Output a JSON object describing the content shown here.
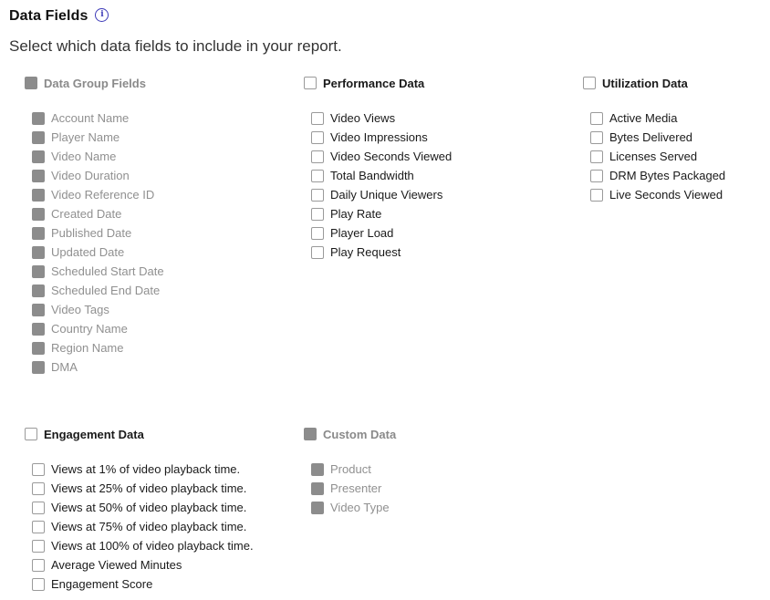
{
  "header": {
    "title": "Data Fields",
    "info_icon": "info-circle-icon"
  },
  "subtitle": "Select which data fields to include in your report.",
  "groups": {
    "data_group": {
      "label": "Data Group Fields",
      "items": [
        "Account Name",
        "Player Name",
        "Video Name",
        "Video Duration",
        "Video Reference ID",
        "Created Date",
        "Published Date",
        "Updated Date",
        "Scheduled Start Date",
        "Scheduled End Date",
        "Video Tags",
        "Country Name",
        "Region Name",
        "DMA"
      ]
    },
    "performance": {
      "label": "Performance Data",
      "items": [
        "Video Views",
        "Video Impressions",
        "Video Seconds Viewed",
        "Total Bandwidth",
        "Daily Unique Viewers",
        "Play Rate",
        "Player Load",
        "Play Request"
      ]
    },
    "utilization": {
      "label": "Utilization Data",
      "items": [
        "Active Media",
        "Bytes Delivered",
        "Licenses Served",
        "DRM Bytes Packaged",
        "Live Seconds Viewed"
      ]
    },
    "engagement": {
      "label": "Engagement Data",
      "items": [
        "Views at 1% of video playback time.",
        "Views at 25% of video playback time.",
        "Views at 50% of video playback time.",
        "Views at 75% of video playback time.",
        "Views at 100% of video playback time.",
        "Average Viewed Minutes",
        "Engagement Score"
      ]
    },
    "custom": {
      "label": "Custom Data",
      "items": [
        "Product",
        "Presenter",
        "Video Type"
      ]
    }
  },
  "colors": {
    "disabled_checkbox": "#8c8c8c",
    "accent": "#3d3ab8"
  }
}
